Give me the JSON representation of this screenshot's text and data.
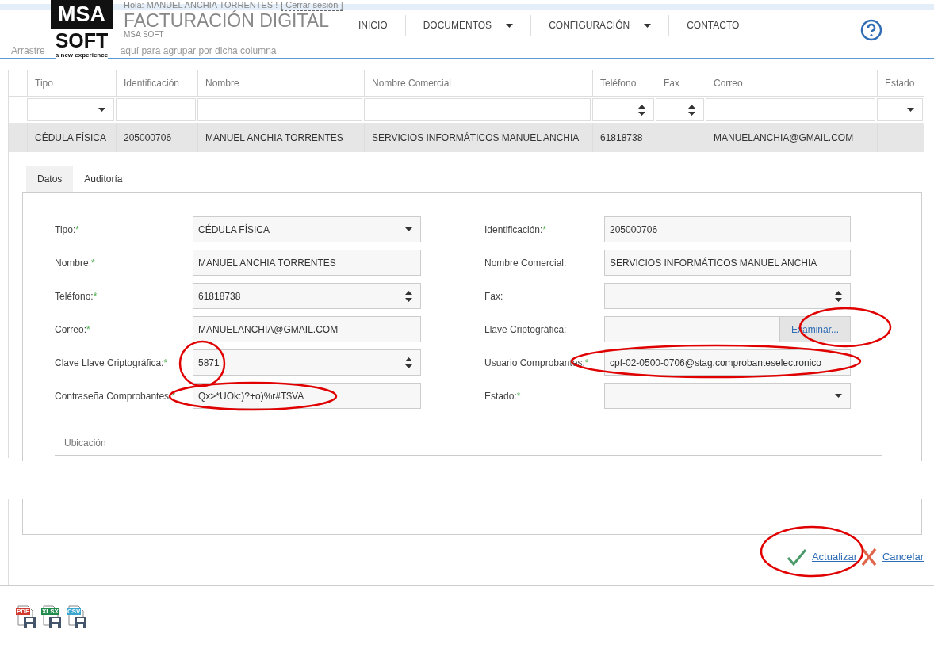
{
  "header": {
    "greeting": "Hola: MANUEL ANCHIA TORRENTES !",
    "logout": "[ Cerrar sesión ]",
    "logo": {
      "top": "MSA",
      "bottom": "SOFT",
      "tagline": "a new experience"
    },
    "title": "FACTURACIÓN DIGITAL",
    "subtitle": "MSA SOFT",
    "nav": [
      {
        "label": "INICIO",
        "dropdown": false
      },
      {
        "label": "DOCUMENTOS",
        "dropdown": true
      },
      {
        "label": "CONFIGURACIÓN",
        "dropdown": true
      },
      {
        "label": "CONTACTO",
        "dropdown": false
      }
    ],
    "group_hint": [
      "Arrastre",
      "aquí para agrupar por dicha columna"
    ]
  },
  "grid": {
    "columns": [
      {
        "label": "Tipo",
        "kind": "select"
      },
      {
        "label": "Identificación",
        "kind": "text"
      },
      {
        "label": "Nombre",
        "kind": "text"
      },
      {
        "label": "Nombre Comercial",
        "kind": "text"
      },
      {
        "label": "Teléfono",
        "kind": "spin"
      },
      {
        "label": "Fax",
        "kind": "spin"
      },
      {
        "label": "Correo",
        "kind": "text"
      },
      {
        "label": "Estado",
        "kind": "select"
      }
    ],
    "rows": [
      {
        "selected": true,
        "cells": [
          "CÉDULA FÍSICA",
          "205000706",
          "MANUEL ANCHIA TORRENTES",
          "SERVICIOS INFORMÁTICOS MANUEL ANCHIA",
          "61818738",
          "",
          "MANUELANCHIA@GMAIL.COM",
          ""
        ]
      }
    ]
  },
  "tabs": [
    {
      "label": "Datos",
      "selected": true
    },
    {
      "label": "Auditoría",
      "selected": false
    }
  ],
  "form": {
    "left": [
      {
        "label": "Tipo:",
        "required_mark": "*",
        "kind": "select",
        "value": "CÉDULA FÍSICA"
      },
      {
        "label": "Nombre:",
        "required_mark": "*",
        "kind": "text",
        "value": "MANUEL ANCHIA TORRENTES"
      },
      {
        "label": "Teléfono:",
        "required_mark": "*",
        "kind": "spin",
        "value": "61818738"
      },
      {
        "label": "Correo:",
        "required_mark": "*",
        "kind": "text",
        "value": "MANUELANCHIA@GMAIL.COM"
      },
      {
        "label": "Clave Llave Criptográfica:",
        "required_mark": "*",
        "kind": "spin",
        "value": "5871"
      },
      {
        "label": "Contraseña Comprobantes:",
        "required_mark": "*",
        "kind": "text",
        "value": "Qx>*UOk:)?+o)%r#T$VA"
      }
    ],
    "right": [
      {
        "label": "Identificación:",
        "required_mark": "*",
        "kind": "text",
        "value": "205000706"
      },
      {
        "label": "Nombre Comercial:",
        "kind": "text",
        "value": "SERVICIOS INFORMÁTICOS MANUEL ANCHIA"
      },
      {
        "label": "Fax:",
        "kind": "spin"
      },
      {
        "label": "Llave Criptográfica:",
        "kind": "file",
        "button": "Examinar..."
      },
      {
        "label": "Usuario Comprobantes:",
        "required_mark": "*",
        "kind": "text",
        "value": "cpf-02-0500-0706@stag.comprobanteselectronico"
      },
      {
        "label": "Estado:",
        "required_mark": "*",
        "kind": "select"
      }
    ]
  },
  "section": "Ubicación",
  "actions": [
    {
      "label": "Actualizar",
      "kind": "confirm"
    },
    {
      "label": "Cancelar",
      "kind": "cancel"
    }
  ],
  "exports": [
    {
      "label": "PDF",
      "color": "#d03a2f"
    },
    {
      "label": "XLSX",
      "color": "#1f8a4c"
    },
    {
      "label": "CSV",
      "color": "#3aa6d0"
    }
  ]
}
